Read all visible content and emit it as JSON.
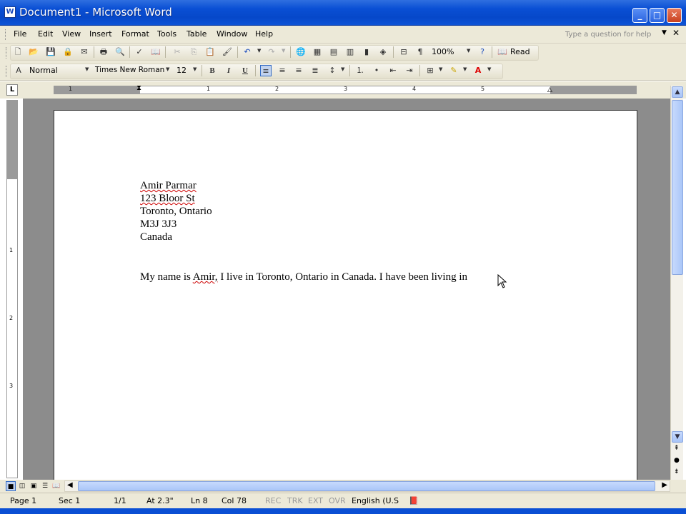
{
  "window": {
    "title": "Document1 - Microsoft Word",
    "app_icon": "word-icon"
  },
  "menu": {
    "items": [
      "File",
      "Edit",
      "View",
      "Insert",
      "Format",
      "Tools",
      "Table",
      "Window",
      "Help"
    ],
    "help_placeholder": "Type a question for help"
  },
  "standard_toolbar": {
    "zoom": "100%",
    "read_label": "Read"
  },
  "format_toolbar": {
    "style": "Normal",
    "font": "Times New Roman",
    "size": "12",
    "bold": "B",
    "italic": "I",
    "underline": "U"
  },
  "ruler": {
    "numbers": [
      "1",
      "1",
      "2",
      "3",
      "4",
      "5"
    ],
    "vnumbers": [
      "1",
      "2",
      "3"
    ]
  },
  "document": {
    "lines": [
      "Amir Parmar",
      "123 Bloor St",
      "Toronto, Ontario",
      "M3J 3J3",
      "Canada"
    ],
    "body_before": "My name is ",
    "body_misspelled": "Amir,",
    "body_after": " I live in Toronto, Ontario in Canada. I have been living in"
  },
  "status": {
    "page": "Page  1",
    "sec": "Sec  1",
    "pages": "1/1",
    "at": "At  2.3\"",
    "ln": "Ln  8",
    "col": "Col  78",
    "rec": "REC",
    "trk": "TRK",
    "ext": "EXT",
    "ovr": "OVR",
    "lang": "English (U.S"
  }
}
